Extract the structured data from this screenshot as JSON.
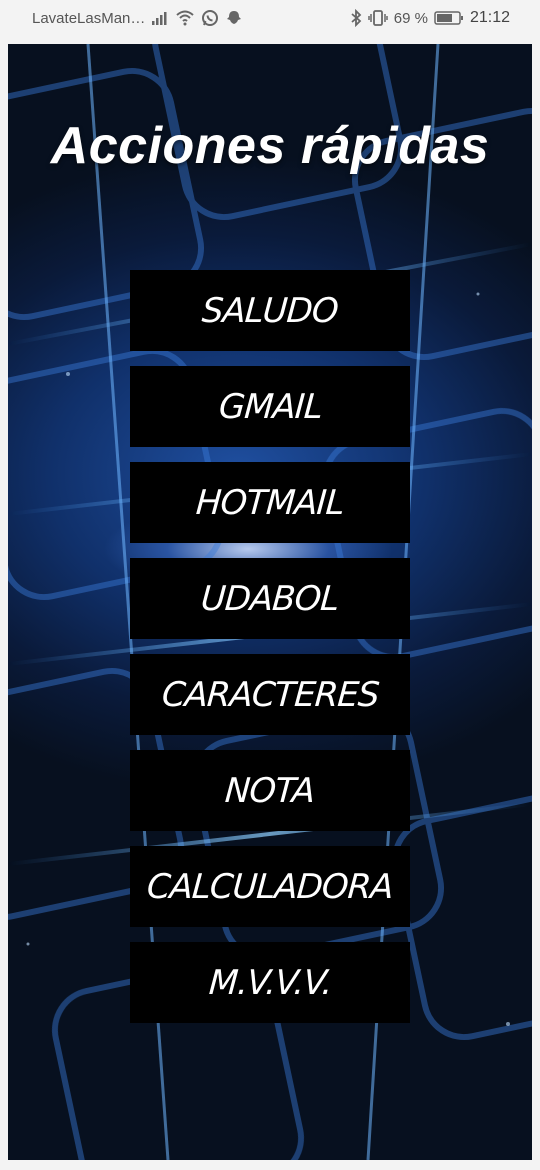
{
  "status_bar": {
    "carrier_text": "LavateLasMan…",
    "battery_percent": "69 %",
    "time": "21:12",
    "icons": [
      "signal-icon",
      "wifi-icon",
      "whatsapp-icon",
      "snapchat-icon",
      "bluetooth-icon",
      "vibrate-icon",
      "battery-icon"
    ]
  },
  "page": {
    "title": "Acciones rápidas"
  },
  "buttons": [
    {
      "label": "SALUDO"
    },
    {
      "label": "GMAIL"
    },
    {
      "label": "HOTMAIL"
    },
    {
      "label": "UDABOL"
    },
    {
      "label": "CARACTERES"
    },
    {
      "label": "NOTA"
    },
    {
      "label": "CALCULADORA"
    },
    {
      "label": "M.V.V.V."
    }
  ],
  "colors": {
    "button_bg": "#000000",
    "button_text": "#ffffff",
    "background_dark": "#0a1530",
    "glow_blue": "#3a8bff"
  }
}
